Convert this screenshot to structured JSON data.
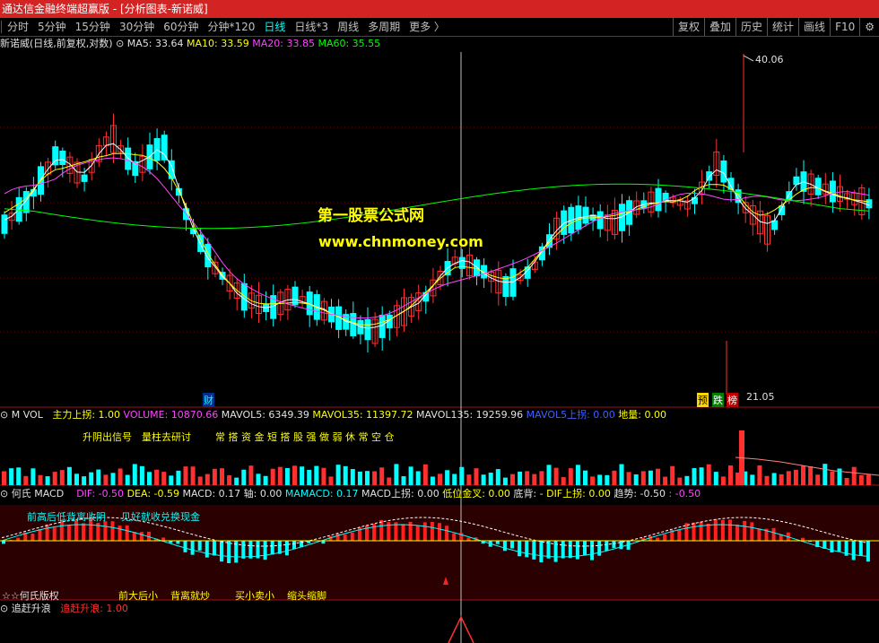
{
  "window": {
    "title": "通达信金融终端超赢版 - [分析图表-新诺威]"
  },
  "periods": [
    "分时",
    "5分钟",
    "15分钟",
    "30分钟",
    "60分钟",
    "分钟*120",
    "日线",
    "日线*3",
    "周线",
    "多周期",
    "更多 〉"
  ],
  "active_period": "日线",
  "right_menu": [
    "复权",
    "叠加",
    "历史",
    "统计",
    "画线",
    "F10",
    "⚙"
  ],
  "main_info": {
    "stock": "新诺威(日线,前复权,对数)",
    "ma5": "MA5: 33.64",
    "ma10": "MA10: 33.59",
    "ma20": "MA20: 33.85",
    "ma60": "MA60: 35.55"
  },
  "price_high_label": "40.06",
  "price_low_label": "21.05",
  "watermark": {
    "line1": "第一股票公式网",
    "line2": "www.chnmoney.com"
  },
  "tags": {
    "cai": "财",
    "yu": "预",
    "die": "跌",
    "bang": "榜"
  },
  "vol_info": {
    "name": "M VOL",
    "zhuli": "主力上拐: 1.00",
    "volume": "VOLUME: 10870.66",
    "mavol5": "MAVOL5: 6349.39",
    "mavol35": "MAVOL35: 11397.72",
    "mavol135": "MAVOL135: 19259.96",
    "mavol5s": "MAVOL5上拐: 0.00",
    "diliang": "地量: 0.00"
  },
  "vol_notes": {
    "a": "升阴出信号",
    "b": "量柱去研讨",
    "c": "常 搭 资 金 短 搭 股 强 做 弱 休 常 空 仓"
  },
  "macd_info": {
    "name": "何氏 MACD",
    "dif": "DIF: -0.50",
    "dea": "DEA: -0.59",
    "macd": "MACD: 0.17",
    "zhou": "轴: 0.00",
    "mamacd": "MAMACD: 0.17",
    "macds": "MACD上拐: 0.00",
    "diwei": "低位金叉: 0.00",
    "dibei": "底背: -",
    "difs": "DIF上拐: 0.00",
    "qushi": "趋势: -0.50",
    "qushi2": ": -0.50"
  },
  "macd_notes": {
    "a": "前高后低背离收阴",
    "b": "见好就收兑换现金",
    "c": "☆☆何氏版权",
    "d": "前大后小",
    "e": "背离就炒",
    "f": "买小卖小",
    "g": "缩头缩脚"
  },
  "zg_info": {
    "name": "追赶升浪",
    "value": "追赶升浪: 1.00"
  }
}
